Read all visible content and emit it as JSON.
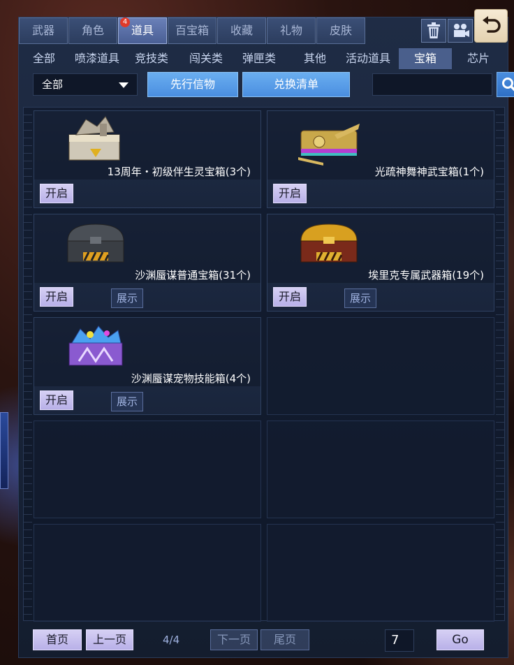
{
  "top_tabs": [
    {
      "label": "武器",
      "active": false
    },
    {
      "label": "角色",
      "active": false
    },
    {
      "label": "道具",
      "active": true,
      "badge": "4"
    },
    {
      "label": "百宝箱",
      "active": false
    },
    {
      "label": "收藏",
      "active": false
    },
    {
      "label": "礼物",
      "active": false
    },
    {
      "label": "皮肤",
      "active": false
    }
  ],
  "sub_tabs": [
    {
      "label": "全部"
    },
    {
      "label": "喷漆道具"
    },
    {
      "label": "竞技类"
    },
    {
      "label": "闯关类"
    },
    {
      "label": "弹匣类"
    },
    {
      "label": "其他"
    },
    {
      "label": "活动道具"
    },
    {
      "label": "宝箱",
      "active": true
    },
    {
      "label": "芯片"
    }
  ],
  "filter": {
    "select_value": "全部",
    "btn_preview": "先行信物",
    "btn_exchange": "兑换清单",
    "search_placeholder": ""
  },
  "items": [
    {
      "name": "13周年・初级伴生灵宝箱(3个)",
      "open_label": "开启",
      "show_label": "",
      "icon": "silver-gold-chest"
    },
    {
      "name": "光疏神舞神武宝箱(1个)",
      "open_label": "开启",
      "show_label": "",
      "icon": "golden-ornate-chest"
    },
    {
      "name": "沙渊蜃谋普通宝箱(31个)",
      "open_label": "开启",
      "show_label": "展示",
      "icon": "gray-hazard-chest"
    },
    {
      "name": "埃里克专属武器箱(19个)",
      "open_label": "开启",
      "show_label": "展示",
      "icon": "gold-hazard-chest"
    },
    {
      "name": "沙渊蜃谋宠物技能箱(4个)",
      "open_label": "开启",
      "show_label": "展示",
      "icon": "purple-gem-chest"
    }
  ],
  "pager": {
    "first": "首页",
    "prev": "上一页",
    "info": "4/4",
    "next": "下一页",
    "last": "尾页",
    "page_input": "7",
    "go": "Go"
  },
  "colors": {
    "accent_blue": "#4a8ee0",
    "active_tab": "#4a5f95",
    "button_lilac": "#b8b0e8"
  }
}
